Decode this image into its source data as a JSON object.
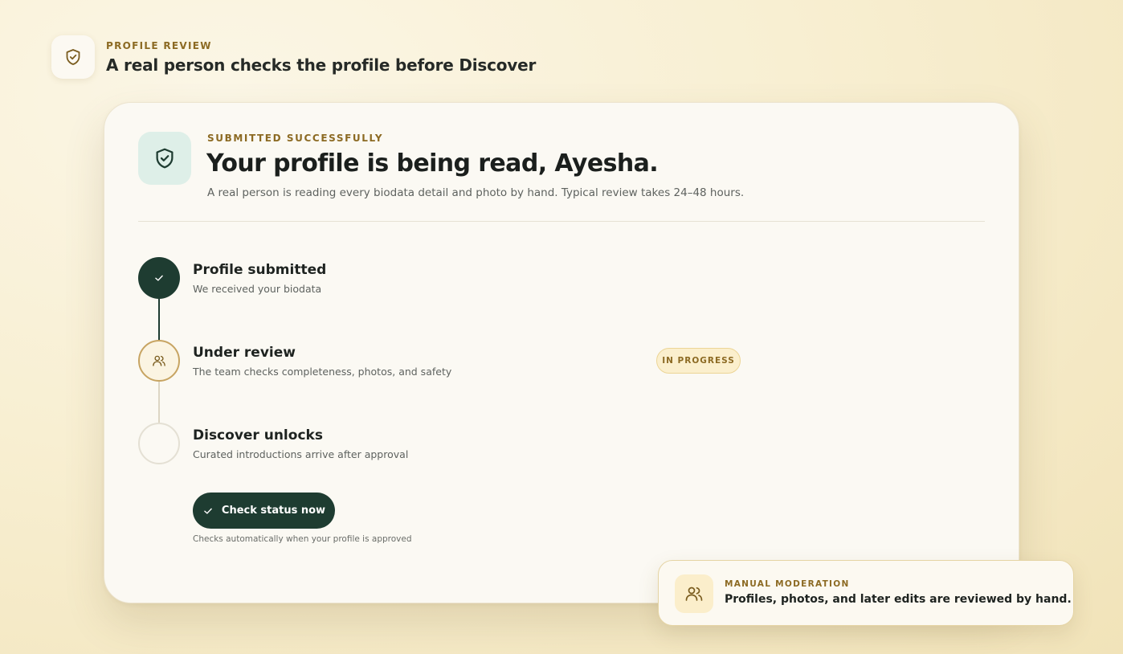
{
  "header": {
    "eyebrow": "PROFILE REVIEW",
    "title": "A real person checks the profile before Discover",
    "icon": "shield-check-icon"
  },
  "card": {
    "icon": "shield-check-icon",
    "eyebrow": "SUBMITTED SUCCESSFULLY",
    "title": "Your profile is being read, Ayesha.",
    "subtitle": "A real person is reading every biodata detail and photo by hand. Typical review takes 24–48 hours."
  },
  "steps": [
    {
      "title": "Profile submitted",
      "description": "We received your biodata",
      "status": "done",
      "icon": "check-icon"
    },
    {
      "title": "Under review",
      "description": "The team checks completeness, photos, and safety",
      "status": "active",
      "icon": "users-icon",
      "badge": "IN PROGRESS"
    },
    {
      "title": "Discover unlocks",
      "description": "Curated introductions arrive after approval",
      "status": "pending"
    }
  ],
  "action": {
    "button_label": "Check status now",
    "button_icon": "check-icon",
    "note": "Checks automatically when your profile is approved"
  },
  "toast": {
    "icon": "users-icon",
    "eyebrow": "MANUAL MODERATION",
    "text": "Profiles, photos, and later edits are reviewed by hand."
  },
  "colors": {
    "accent_green": "#1e3c31",
    "accent_gold": "#8c6a23",
    "badge_bg": "#fbefcd",
    "background": "#f8efd2"
  }
}
